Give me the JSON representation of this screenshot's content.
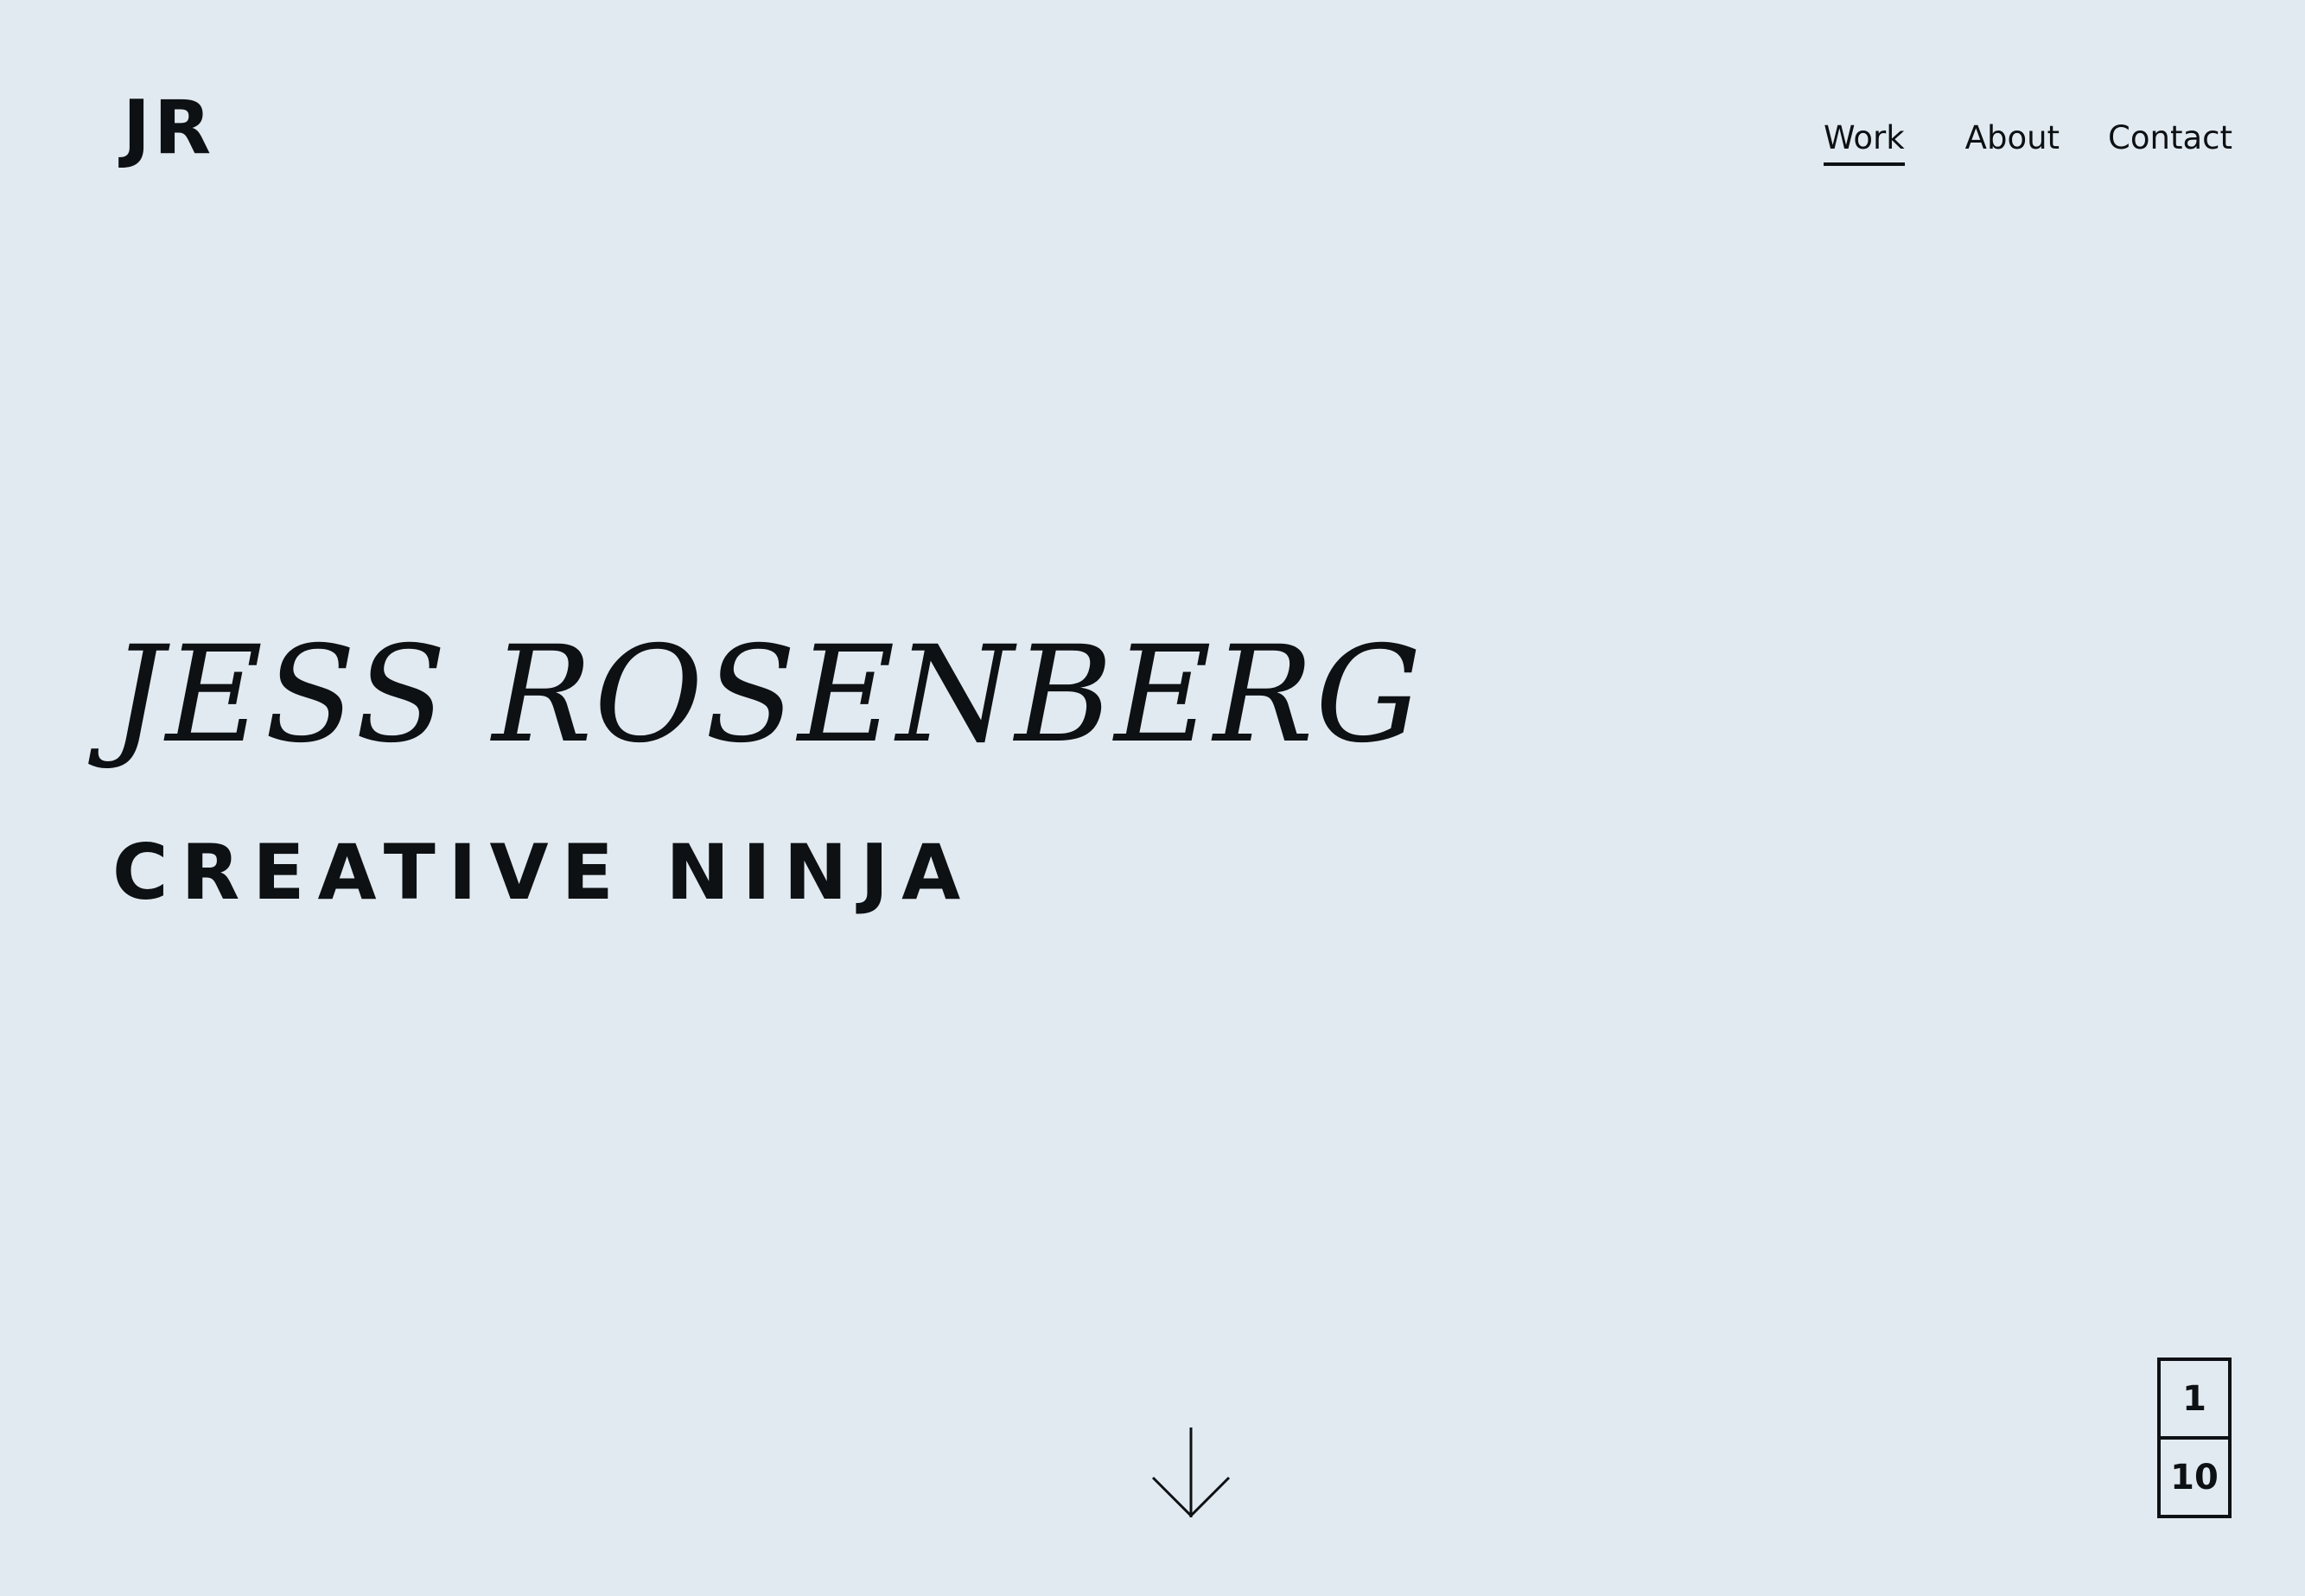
{
  "header": {
    "logo": "JR",
    "nav": {
      "work": "Work",
      "about": "About",
      "contact": "Contact",
      "active": "Work"
    }
  },
  "hero": {
    "name": "JESS ROSENBERG",
    "title": "CREATIVE NINJA"
  },
  "scroll": {
    "icon": "arrow-down-icon"
  },
  "pager": {
    "current": "1",
    "total": "10"
  },
  "colors": {
    "background": "#e2eaf1",
    "text": "#0d1114"
  }
}
